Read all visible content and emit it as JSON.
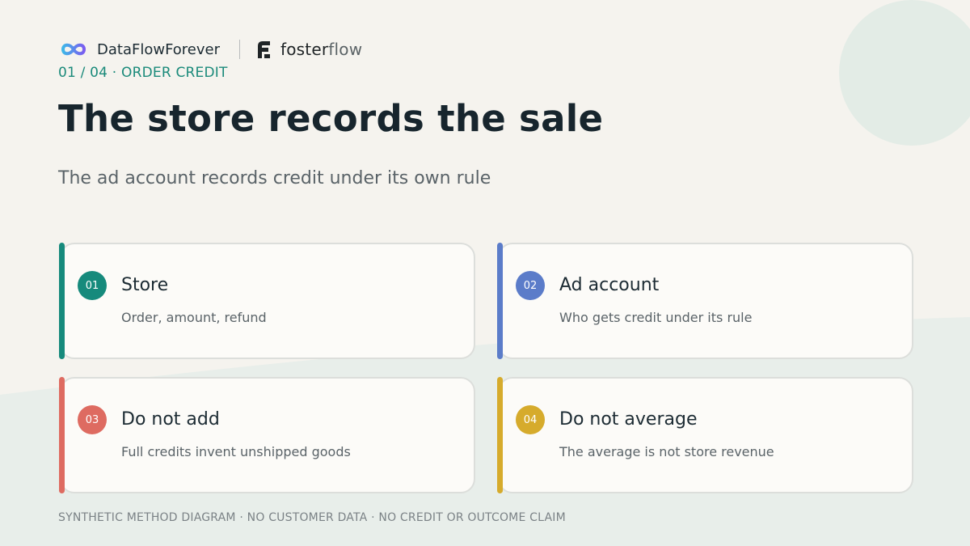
{
  "brand": {
    "name": "DataFlowForever",
    "partner": {
      "bold": "foster",
      "light": "flow"
    },
    "colors": {
      "gradient_start": "#3fb6e8",
      "gradient_end": "#7a5cf0"
    }
  },
  "eyebrow": "01 / 04 · ORDER CREDIT",
  "title": "The store records the sale",
  "subtitle": "The ad account records credit under its own rule",
  "cards": [
    {
      "number": "01",
      "title": "Store",
      "description": "Order, amount, refund",
      "color": "#168a7c"
    },
    {
      "number": "02",
      "title": "Ad account",
      "description": "Who gets credit under its rule",
      "color": "#5b7cc9"
    },
    {
      "number": "03",
      "title": "Do not add",
      "description": "Full credits invent unshipped goods",
      "color": "#de6b61"
    },
    {
      "number": "04",
      "title": "Do not average",
      "description": "The average is not store revenue",
      "color": "#d6ab2c"
    }
  ],
  "footer": "SYNTHETIC METHOD DIAGRAM · NO CUSTOMER DATA · NO CREDIT OR OUTCOME CLAIM"
}
